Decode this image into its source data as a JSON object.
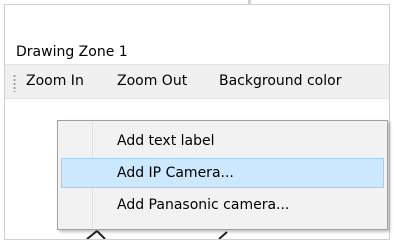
{
  "window": {
    "title": "Drawing Zone 1"
  },
  "toolbar": {
    "items": [
      {
        "label": "Zoom In"
      },
      {
        "label": "Zoom Out"
      },
      {
        "label": "Background color"
      }
    ]
  },
  "context_menu": {
    "items": [
      {
        "label": "Add text label",
        "selected": false
      },
      {
        "label": "Add IP Camera...",
        "selected": true
      },
      {
        "label": "Add Panasonic camera...",
        "selected": false
      }
    ]
  },
  "colors": {
    "selection_fill": "#cce8ff",
    "selection_border": "#99d1ff",
    "toolbar_bg": "#f0f0f0",
    "menu_bg": "#f2f2f2"
  }
}
